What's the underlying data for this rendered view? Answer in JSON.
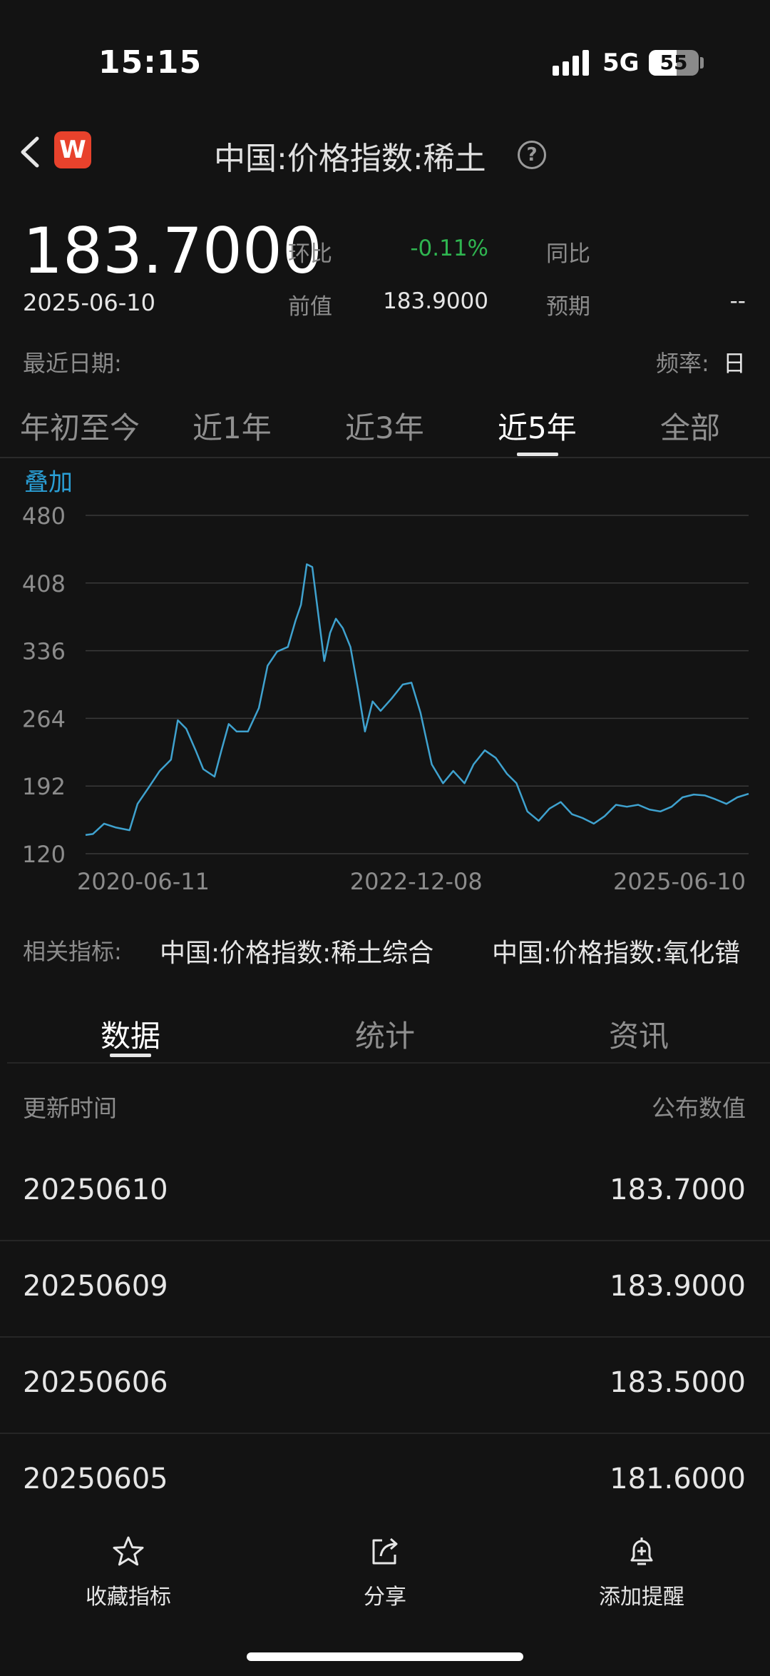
{
  "status": {
    "time": "15:15",
    "network": "5G",
    "battery": "55",
    "battery_level": 0.55
  },
  "nav": {
    "app_logo": "W",
    "title": "中国:价格指数:稀土",
    "help": "?"
  },
  "summary": {
    "value": "183.7000",
    "date": "2025-06-10",
    "mom_label": "环比",
    "mom_value": "-0.11%",
    "yoy_label": "同比",
    "prev_label": "前值",
    "prev_value": "183.9000",
    "forecast_label": "预期",
    "forecast_value": "--",
    "recent_date_label": "最近日期:",
    "freq_label": "频率:",
    "freq_value": "日"
  },
  "range_tabs": [
    "年初至今",
    "近1年",
    "近3年",
    "近5年",
    "全部"
  ],
  "overlay_label": "叠加",
  "colors": {
    "line": "#3fa2cf",
    "accent": "#2a9fd6",
    "up_down": "#2fb550"
  },
  "chart_data": {
    "type": "line",
    "x_range": [
      "2020-06-11",
      "2025-06-10"
    ],
    "xticks": [
      "2020-06-11",
      "2022-12-08",
      "2025-06-10"
    ],
    "yticks": [
      120,
      192,
      264,
      336,
      408,
      480
    ],
    "ylim": [
      120,
      480
    ],
    "grid": true,
    "series": [
      {
        "values": [
          [
            "2020-06-11",
            140
          ],
          [
            "2020-07-01",
            141
          ],
          [
            "2020-08-01",
            152
          ],
          [
            "2020-09-01",
            148
          ],
          [
            "2020-10-10",
            145
          ],
          [
            "2020-11-01",
            173
          ],
          [
            "2020-12-01",
            190
          ],
          [
            "2021-01-01",
            208
          ],
          [
            "2021-02-01",
            220
          ],
          [
            "2021-02-20",
            262
          ],
          [
            "2021-03-15",
            253
          ],
          [
            "2021-04-10",
            230
          ],
          [
            "2021-05-01",
            210
          ],
          [
            "2021-06-01",
            202
          ],
          [
            "2021-06-20",
            230
          ],
          [
            "2021-07-10",
            258
          ],
          [
            "2021-08-01",
            250
          ],
          [
            "2021-09-01",
            250
          ],
          [
            "2021-10-01",
            275
          ],
          [
            "2021-10-25",
            320
          ],
          [
            "2021-11-20",
            335
          ],
          [
            "2021-12-20",
            340
          ],
          [
            "2022-01-10",
            368
          ],
          [
            "2022-01-25",
            385
          ],
          [
            "2022-02-10",
            428
          ],
          [
            "2022-02-25",
            425
          ],
          [
            "2022-03-15",
            370
          ],
          [
            "2022-03-30",
            325
          ],
          [
            "2022-04-15",
            355
          ],
          [
            "2022-05-01",
            370
          ],
          [
            "2022-05-20",
            360
          ],
          [
            "2022-06-10",
            340
          ],
          [
            "2022-07-01",
            295
          ],
          [
            "2022-07-20",
            250
          ],
          [
            "2022-08-10",
            282
          ],
          [
            "2022-09-01",
            272
          ],
          [
            "2022-10-01",
            285
          ],
          [
            "2022-11-01",
            300
          ],
          [
            "2022-11-25",
            302
          ],
          [
            "2022-12-20",
            270
          ],
          [
            "2023-01-20",
            215
          ],
          [
            "2023-02-20",
            195
          ],
          [
            "2023-03-20",
            208
          ],
          [
            "2023-04-20",
            195
          ],
          [
            "2023-05-15",
            215
          ],
          [
            "2023-06-15",
            230
          ],
          [
            "2023-07-15",
            222
          ],
          [
            "2023-08-15",
            205
          ],
          [
            "2023-09-10",
            195
          ],
          [
            "2023-10-10",
            165
          ],
          [
            "2023-11-10",
            155
          ],
          [
            "2023-12-10",
            168
          ],
          [
            "2024-01-10",
            175
          ],
          [
            "2024-02-10",
            162
          ],
          [
            "2024-03-10",
            158
          ],
          [
            "2024-04-10",
            152
          ],
          [
            "2024-05-10",
            160
          ],
          [
            "2024-06-10",
            172
          ],
          [
            "2024-07-10",
            170
          ],
          [
            "2024-08-10",
            172
          ],
          [
            "2024-09-10",
            167
          ],
          [
            "2024-10-10",
            165
          ],
          [
            "2024-11-10",
            170
          ],
          [
            "2024-12-10",
            180
          ],
          [
            "2025-01-10",
            183
          ],
          [
            "2025-02-10",
            182
          ],
          [
            "2025-03-10",
            178
          ],
          [
            "2025-04-10",
            173
          ],
          [
            "2025-05-10",
            180
          ],
          [
            "2025-06-10",
            183.7
          ]
        ]
      }
    ]
  },
  "related": {
    "label": "相关指标:",
    "items": [
      "中国:价格指数:稀土综合",
      "中国:价格指数:氧化镨"
    ]
  },
  "data_tabs": [
    "数据",
    "统计",
    "资讯"
  ],
  "table": {
    "headers": [
      "更新时间",
      "公布数值"
    ],
    "rows": [
      [
        "20250610",
        "183.7000"
      ],
      [
        "20250609",
        "183.9000"
      ],
      [
        "20250606",
        "183.5000"
      ],
      [
        "20250605",
        "181.6000"
      ]
    ]
  },
  "bottom_bar": [
    {
      "icon": "star-icon",
      "label": "收藏指标"
    },
    {
      "icon": "share-icon",
      "label": "分享"
    },
    {
      "icon": "bell-plus-icon",
      "label": "添加提醒"
    }
  ]
}
